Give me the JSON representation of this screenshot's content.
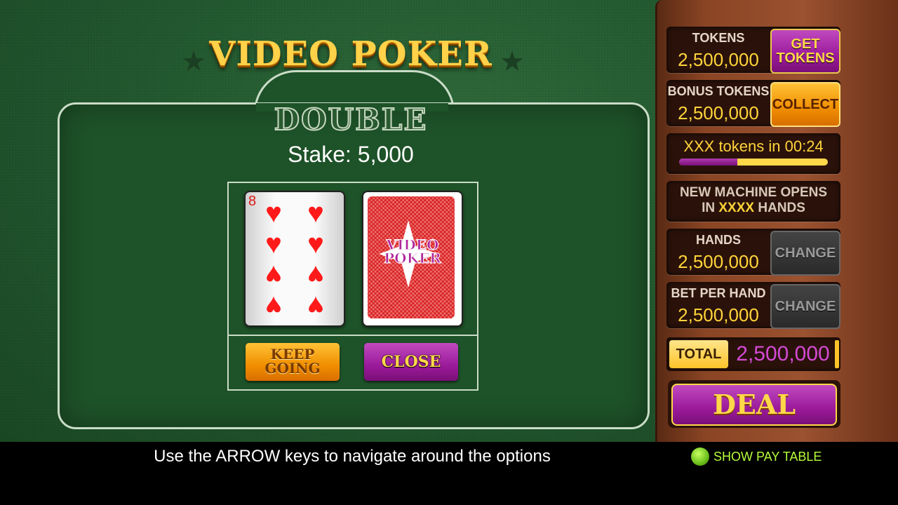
{
  "title": "VIDEO POKER",
  "panel": {
    "heading": "DOUBLE",
    "stake_label": "Stake: 5,000",
    "face_card": {
      "rank": "8",
      "suit": "♥",
      "pip_count": 8
    },
    "back_card": {
      "logo_line1": "VIDEO",
      "logo_line2": "POKER"
    },
    "keep_line1": "KEEP",
    "keep_line2": "GOING",
    "close_label": "CLOSE"
  },
  "sidebar": {
    "tokens": {
      "label": "TOKENS",
      "value": "2,500,000",
      "button_line1": "GET",
      "button_line2": "TOKENS"
    },
    "bonus": {
      "label": "BONUS TOKENS",
      "value": "2,500,000",
      "button": "COLLECT"
    },
    "timer": {
      "text": "XXX tokens in 00:24",
      "progress": 0.39
    },
    "new_machine": {
      "line1": "NEW MACHINE OPENS",
      "line2_prefix": "IN ",
      "line2_highlight": "XXXX",
      "line2_suffix": " HANDS"
    },
    "hands": {
      "label": "HANDS",
      "value": "2,500,000",
      "button": "CHANGE"
    },
    "bet": {
      "label": "BET PER HAND",
      "value": "2,500,000",
      "button": "CHANGE"
    },
    "total": {
      "label": "TOTAL",
      "value": "2,500,000"
    },
    "deal": "DEAL"
  },
  "footer": {
    "hint": "Use the ARROW keys to navigate around the options",
    "pay_table": "SHOW PAY TABLE"
  },
  "colors": {
    "felt": "#1e5228",
    "gold": "#ffd43a",
    "purple": "#9b1a9a",
    "orange": "#f08e00"
  }
}
